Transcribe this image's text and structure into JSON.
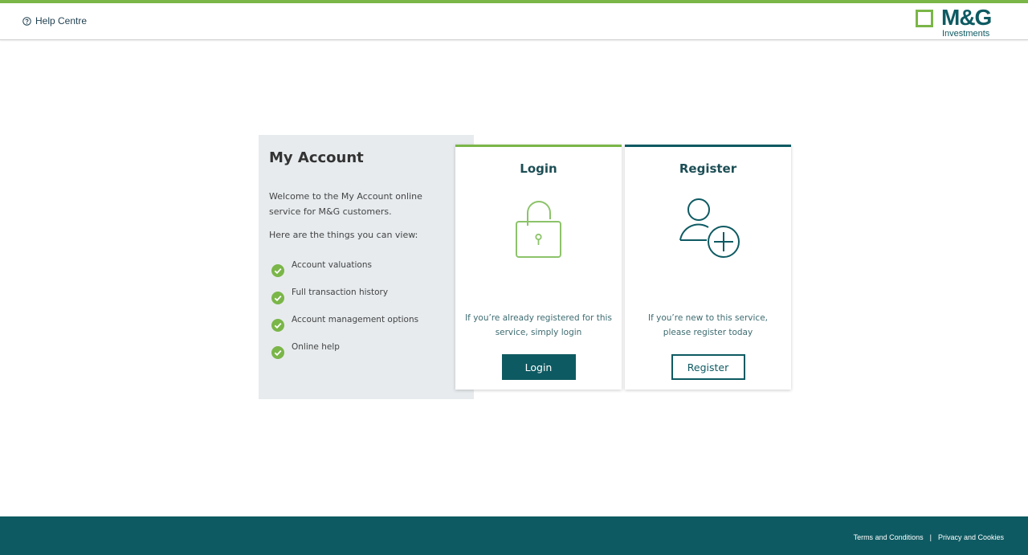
{
  "header": {
    "help_label": "Help Centre",
    "logo": {
      "brand": "M&G",
      "sub": "Investments"
    }
  },
  "colors": {
    "accent_green": "#7ab648",
    "brand_teal": "#0e5a62",
    "panel_bg": "#e7ebee"
  },
  "info": {
    "title": "My Account",
    "intro": "Welcome to the My Account online service for M&G customers.",
    "subhead": "Here are the things you can view:",
    "features": [
      "Account valuations",
      "Full transaction history",
      "Account management options",
      "Online help"
    ]
  },
  "login_card": {
    "title": "Login",
    "icon": "padlock-icon",
    "description": "If you’re already registered for this service, simply login",
    "button": "Login"
  },
  "register_card": {
    "title": "Register",
    "icon": "add-user-icon",
    "description": "If you’re new to this service, please register today",
    "button": "Register"
  },
  "footer": {
    "terms": "Terms and Conditions",
    "separator": "|",
    "privacy": "Privacy and Cookies"
  }
}
